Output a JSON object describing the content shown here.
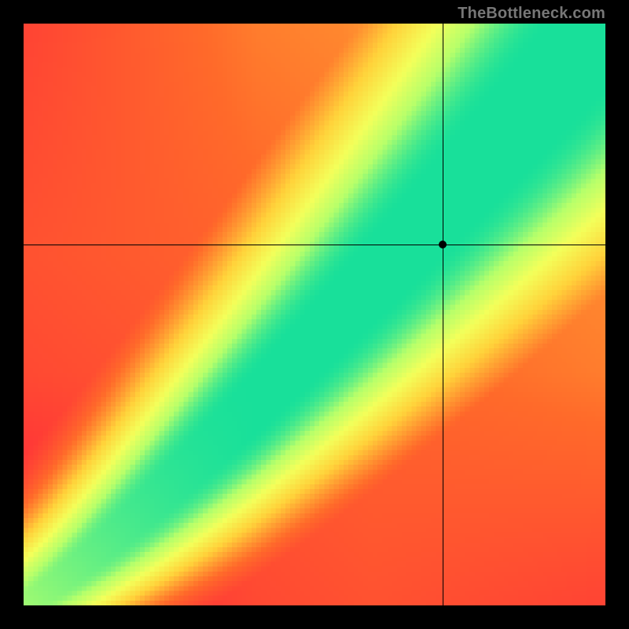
{
  "watermark": "TheBottleneck.com",
  "chart_data": {
    "type": "heatmap",
    "title": "",
    "xlabel": "",
    "ylabel": "",
    "xlim": [
      0,
      1
    ],
    "ylim": [
      0,
      1
    ],
    "grid": false,
    "crosshair": {
      "x": 0.72,
      "y": 0.62
    },
    "marker": {
      "x": 0.72,
      "y": 0.62
    },
    "colorscale": [
      {
        "t": 0.0,
        "color": "#ff2a3a"
      },
      {
        "t": 0.25,
        "color": "#ff6a2a"
      },
      {
        "t": 0.5,
        "color": "#ffd23a"
      },
      {
        "t": 0.7,
        "color": "#f3ff5a"
      },
      {
        "t": 0.85,
        "color": "#b7ff6a"
      },
      {
        "t": 1.0,
        "color": "#18e09a"
      }
    ],
    "ridge": {
      "description": "Green optimal band along a slightly super-linear diagonal y≈x^1.15, widening toward top-right; background fades red→orange→yellow with distance.",
      "exponent": 1.15,
      "band_halfwidth_at_0": 0.015,
      "band_halfwidth_at_1": 0.11,
      "falloff_sigma_at_0": 0.08,
      "falloff_sigma_at_1": 0.3,
      "corner_boosts": [
        {
          "corner": "top-right",
          "value": 0.7
        },
        {
          "corner": "top-left",
          "value": 0.0
        },
        {
          "corner": "bottom-left",
          "value": 0.0
        },
        {
          "corner": "bottom-right",
          "value": 0.0
        }
      ]
    },
    "resolution": 120
  }
}
